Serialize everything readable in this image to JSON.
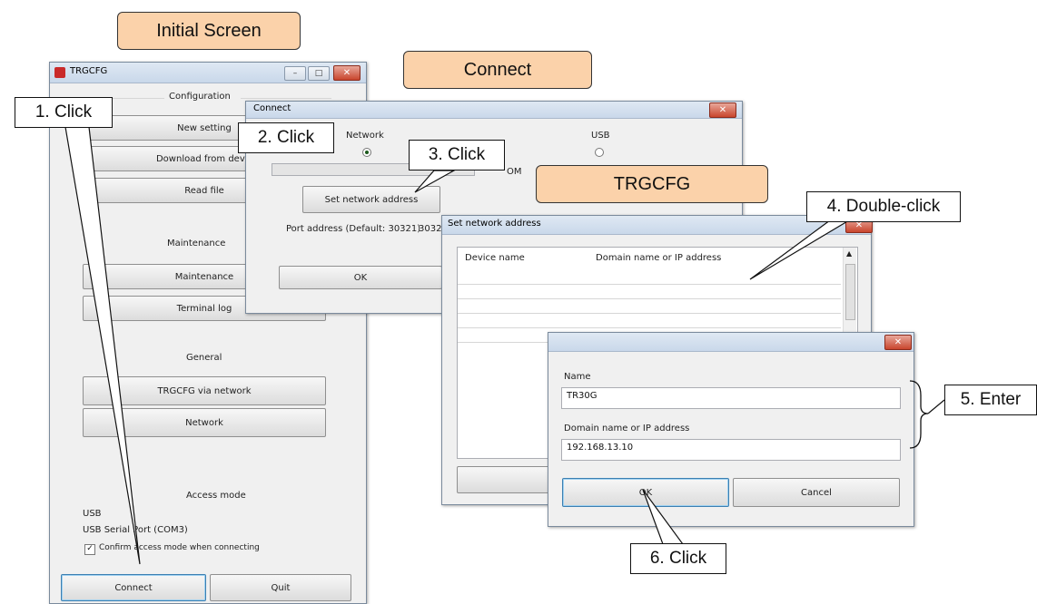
{
  "labels": {
    "initial_screen": "Initial Screen",
    "connect": "Connect",
    "trgcfg": "TRGCFG"
  },
  "callouts": {
    "step1": "1. Click",
    "step2": "2. Click",
    "step3": "3. Click",
    "step4": "4. Double-click",
    "step5": "5. Enter",
    "step6": "6. Click"
  },
  "main_window": {
    "title": "TRGCFG",
    "configuration_heading": "Configuration",
    "new_setting": "New setting",
    "download_from_device": "Download from devic",
    "read_file": "Read file",
    "maintenance_heading": "Maintenance",
    "maintenance_button": "Maintenance",
    "terminal_log": "Terminal log",
    "general_heading": "General",
    "trgcfg_via_network": "TRGCFG via network",
    "network_button": "Network",
    "access_mode_heading": "Access mode",
    "access_usb": "USB",
    "access_port": "USB Serial Port (COM3)",
    "confirm_checkbox": "Confirm access mode when connecting",
    "connect_button": "Connect",
    "quit_button": "Quit"
  },
  "connect_dialog": {
    "title": "Connect",
    "network_label": "Network",
    "usb_label": "USB",
    "com_label": "OM",
    "set_network_address": "Set network address",
    "port_address_label": "Port address (Default: 30321)",
    "port_address_value": "30321",
    "ok_button": "OK"
  },
  "netaddr_dialog": {
    "title": "Set network address",
    "col_device_name": "Device name",
    "col_domain": "Domain name or IP address"
  },
  "entry_dialog": {
    "name_label": "Name",
    "name_value": "TR30G",
    "domain_label": "Domain name or IP address",
    "domain_value": "192.168.13.10",
    "ok_button": "OK",
    "cancel_button": "Cancel"
  },
  "colors": {
    "label_fill": "#fbd2aa",
    "close_button": "#c9452d",
    "focus_border": "#3c7fb1"
  }
}
